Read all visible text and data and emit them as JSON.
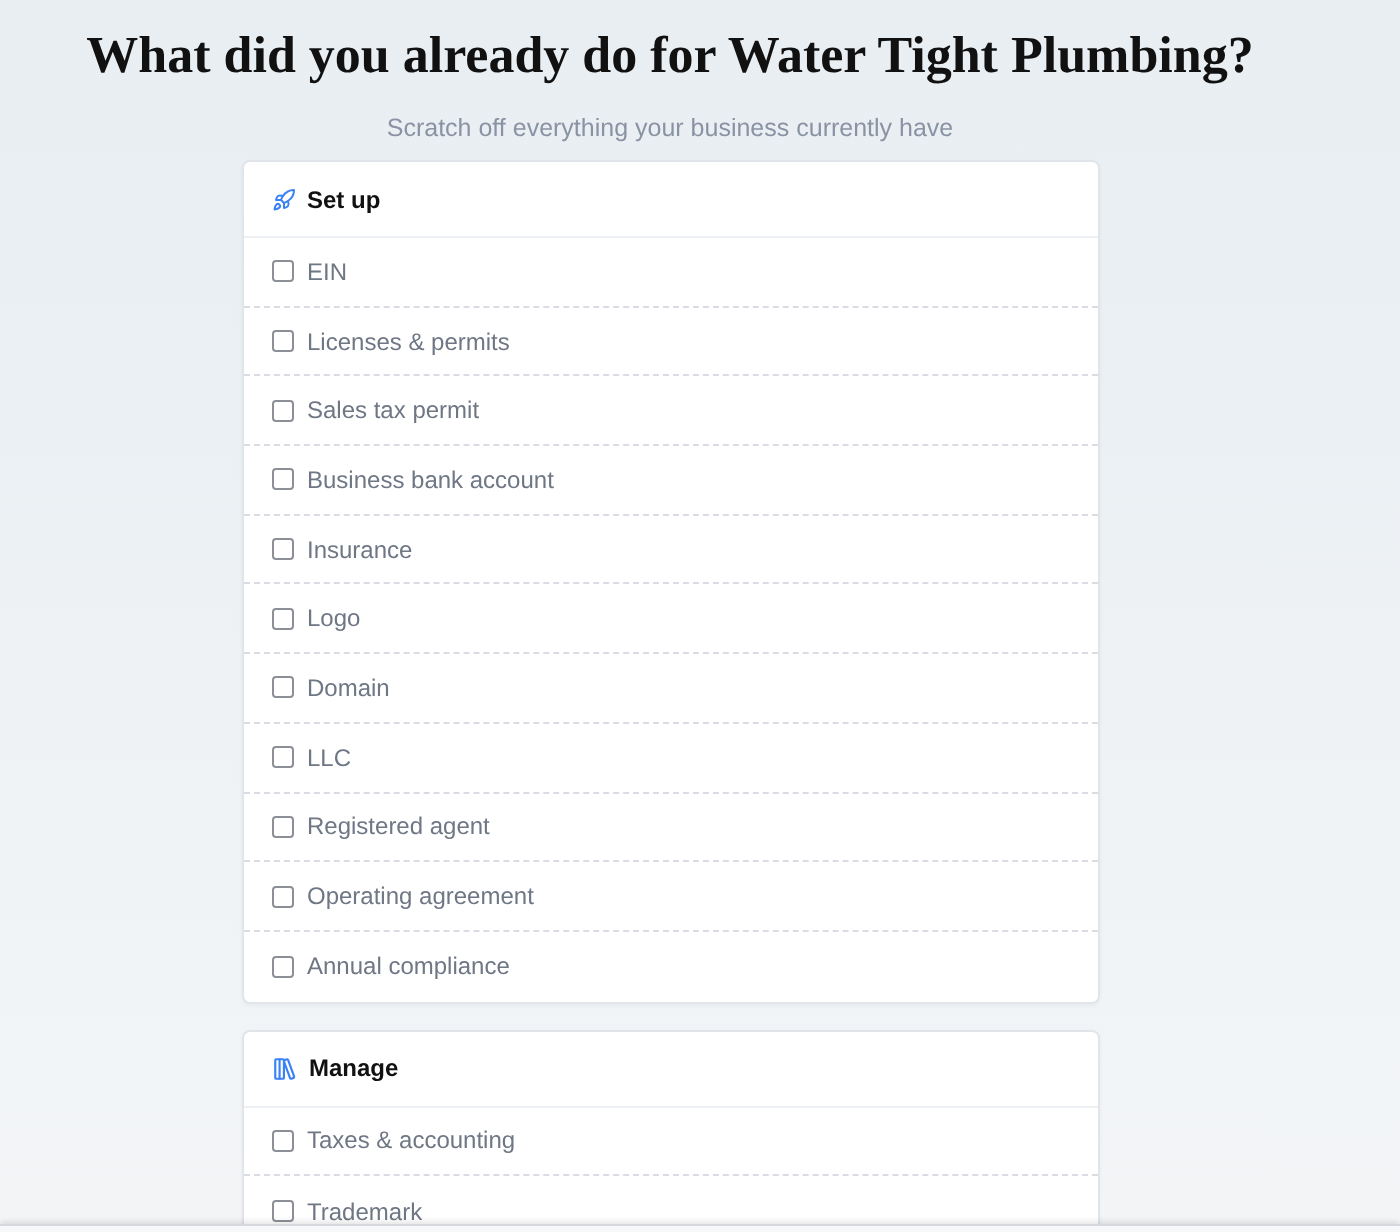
{
  "title": "What did you already do for Water Tight Plumbing?",
  "subtitle": "Scratch off everything your business currently have",
  "sections": [
    {
      "title": "Set up",
      "items": [
        {
          "label": "EIN",
          "checked": false
        },
        {
          "label": "Licenses & permits",
          "checked": false
        },
        {
          "label": "Sales tax permit",
          "checked": false
        },
        {
          "label": "Business bank account",
          "checked": false
        },
        {
          "label": "Insurance",
          "checked": false
        },
        {
          "label": "Logo",
          "checked": false
        },
        {
          "label": "Domain",
          "checked": false
        },
        {
          "label": "LLC",
          "checked": false
        },
        {
          "label": "Registered agent",
          "checked": false
        },
        {
          "label": "Operating agreement",
          "checked": false
        },
        {
          "label": "Annual compliance",
          "checked": false
        }
      ]
    },
    {
      "title": "Manage",
      "items": [
        {
          "label": "Taxes & accounting",
          "checked": false
        },
        {
          "label": "Trademark",
          "checked": false
        }
      ]
    }
  ]
}
